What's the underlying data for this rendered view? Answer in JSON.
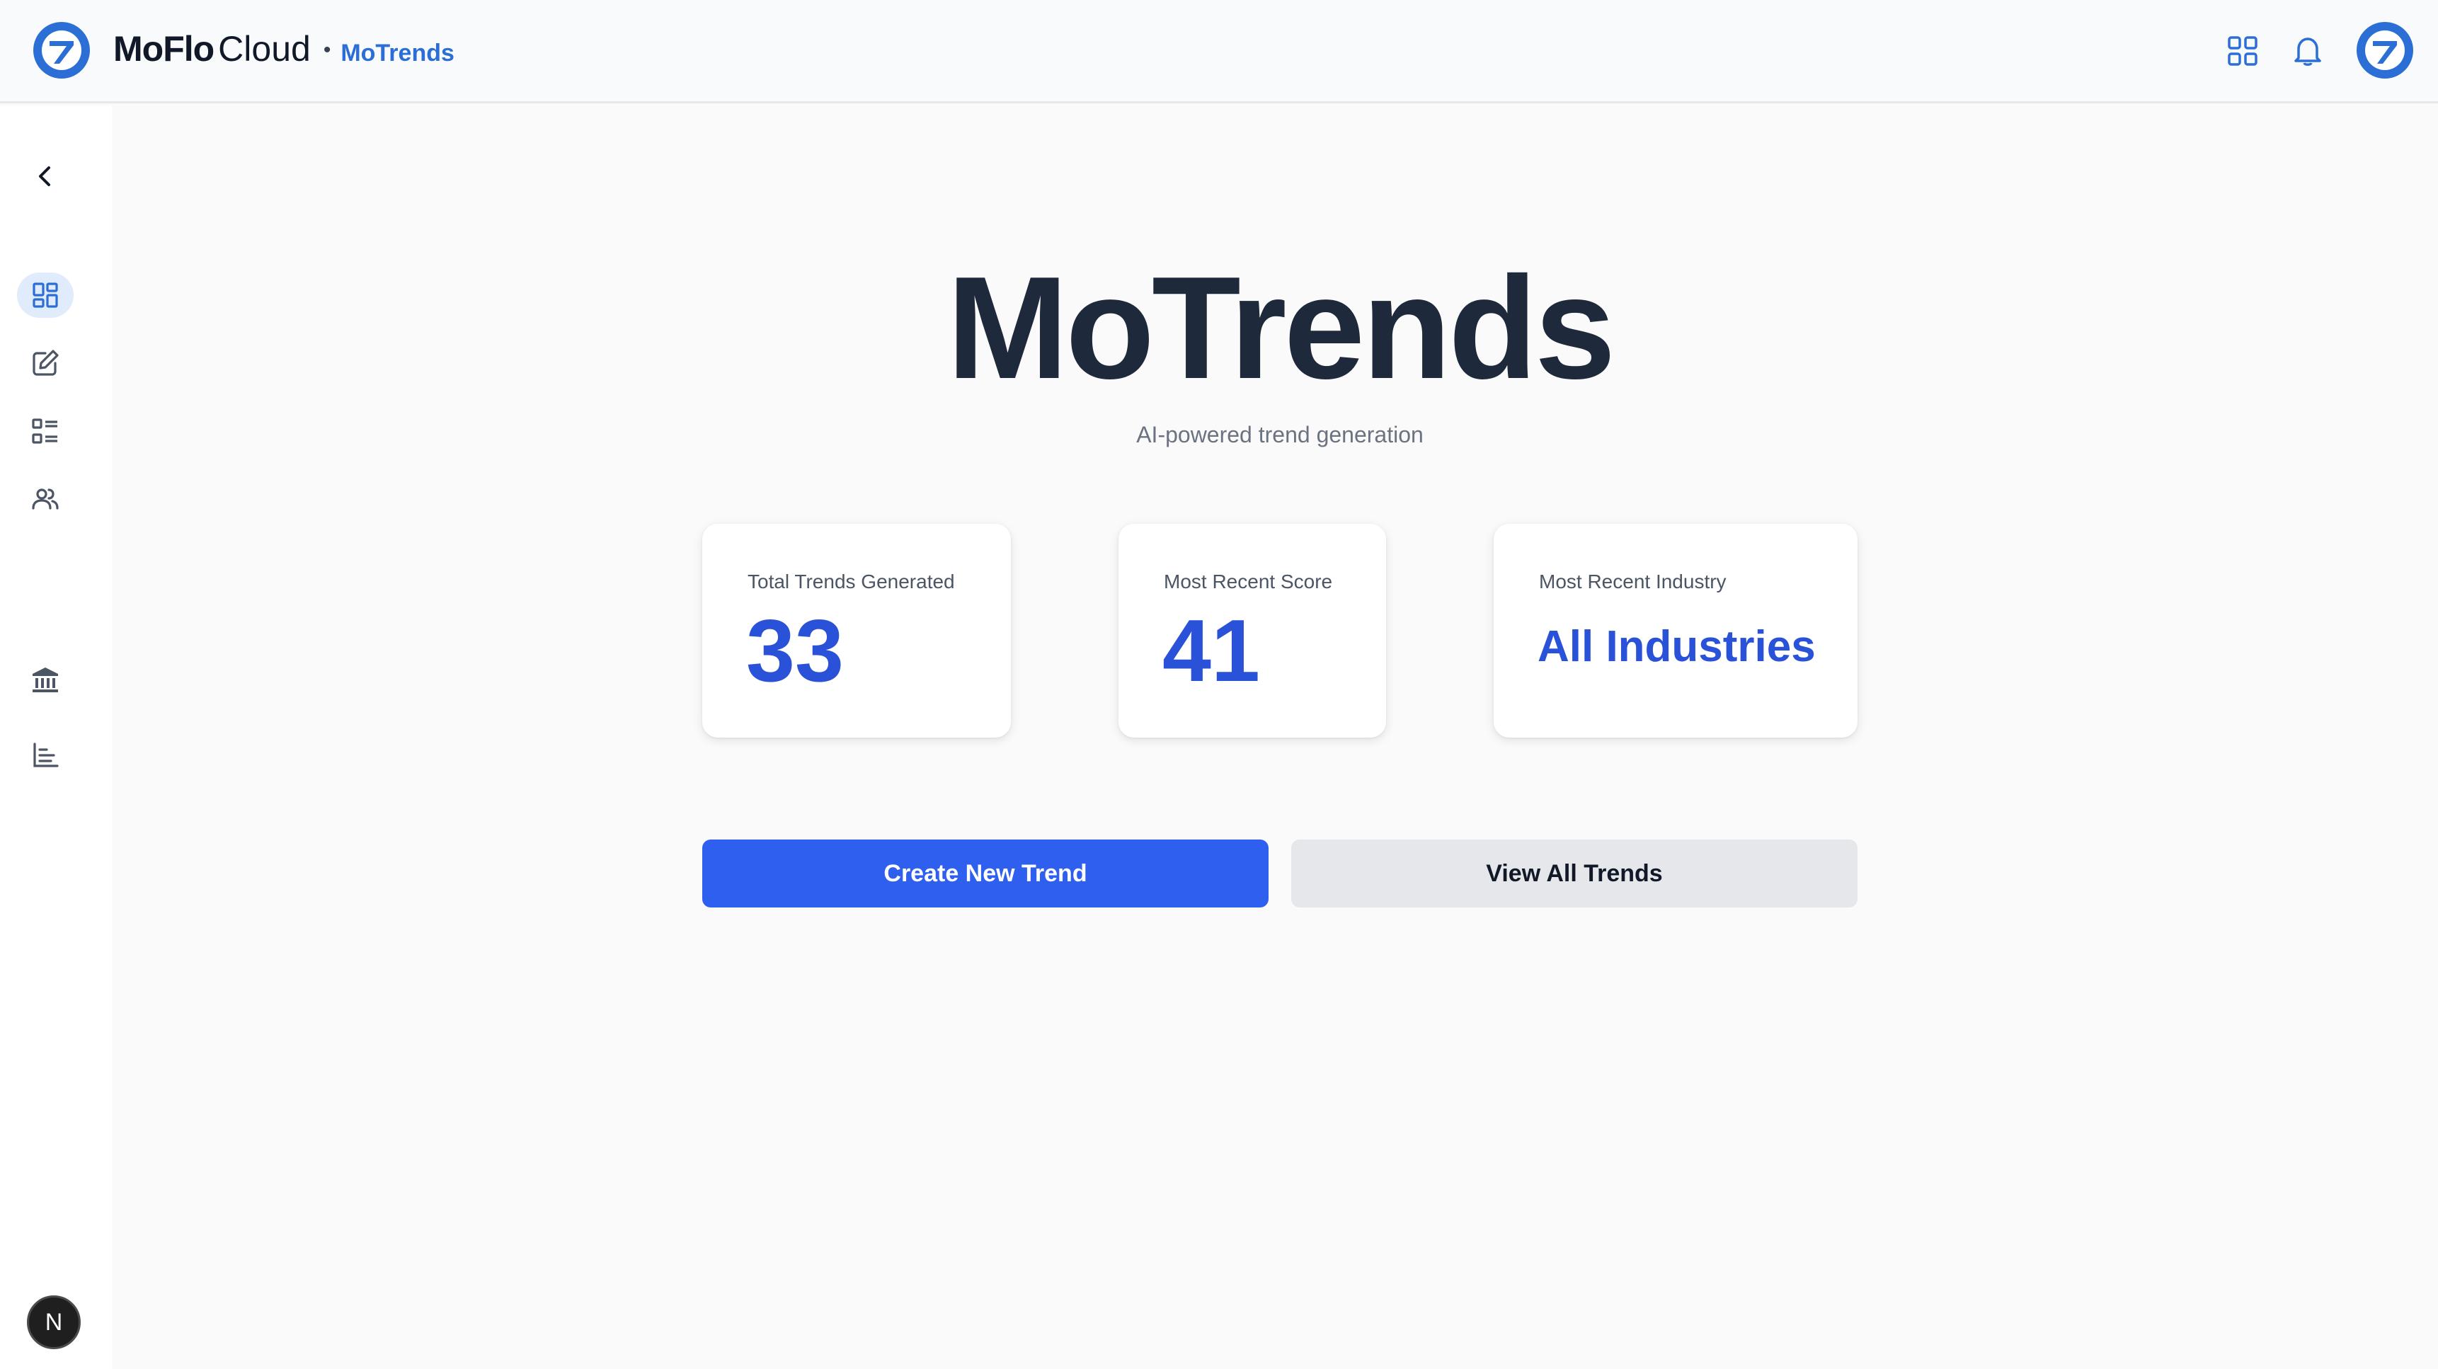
{
  "header": {
    "brand_bold": "MoFlo",
    "brand_light": "Cloud",
    "separator": "•",
    "app_name": "MoTrends",
    "icons": [
      "app-grid-icon",
      "bell-icon",
      "user-avatar-icon"
    ]
  },
  "sidebar": {
    "collapse_icon": "chevron-left-icon",
    "items": [
      {
        "icon": "dashboard-icon",
        "active": true
      },
      {
        "icon": "edit-icon",
        "active": false
      },
      {
        "icon": "list-icon",
        "active": false
      },
      {
        "icon": "users-icon",
        "active": false
      },
      {
        "icon": "bank-icon",
        "active": false
      },
      {
        "icon": "bar-chart-icon",
        "active": false
      }
    ],
    "badge_letter": "N"
  },
  "main": {
    "title": "MoTrends",
    "subtitle": "AI-powered trend generation",
    "stats": [
      {
        "label": "Total Trends Generated",
        "value": "33"
      },
      {
        "label": "Most Recent Score",
        "value": "41"
      },
      {
        "label": "Most Recent Industry",
        "value": "All Industries"
      }
    ],
    "buttons": {
      "primary": "Create New Trend",
      "secondary": "View All Trends"
    }
  },
  "colors": {
    "accent": "#2f5fef",
    "value_blue": "#2a52d9",
    "brand_blue": "#2b6fd6",
    "title_dark": "#1e293b"
  }
}
